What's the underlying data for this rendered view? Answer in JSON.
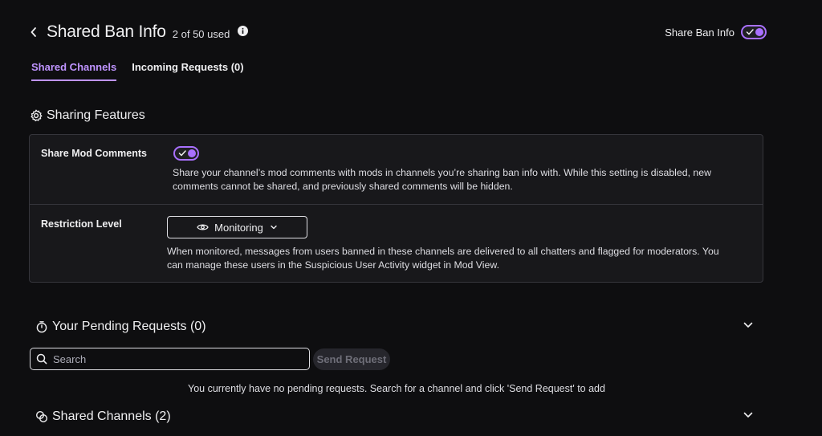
{
  "header": {
    "title": "Shared Ban Info",
    "usage": "2 of 50 used",
    "share_toggle_label": "Share Ban Info",
    "share_toggle_on": true
  },
  "tabs": [
    {
      "label": "Shared Channels",
      "active": true
    },
    {
      "label": "Incoming Requests (0)",
      "active": false
    }
  ],
  "sharing_features": {
    "heading": "Sharing Features",
    "share_mod_comments": {
      "label": "Share Mod Comments",
      "enabled": true,
      "description_line1": "Share your channel’s mod comments with mods in channels you’re sharing ban info with. While this setting is disabled, new",
      "description_line2": "comments cannot be shared, and previously shared comments will be hidden."
    },
    "restriction_level": {
      "label": "Restriction Level",
      "selected": "Monitoring",
      "description_line1": "When monitored, messages from users banned in these channels are delivered to all chatters and flagged for moderators. You",
      "description_line2": "can manage these users in the Suspicious User Activity widget in Mod View."
    }
  },
  "pending_requests": {
    "heading": "Your Pending Requests (0)",
    "search_placeholder": "Search",
    "send_button": "Send Request",
    "empty_message": "You currently have no pending requests. Search for a channel and click 'Send Request' to add"
  },
  "shared_channels": {
    "heading": "Shared Channels (2)"
  },
  "colors": {
    "accent": "#a970ff",
    "accent_text": "#bf94ff",
    "background": "#0e0e10",
    "card": "#18181b"
  }
}
